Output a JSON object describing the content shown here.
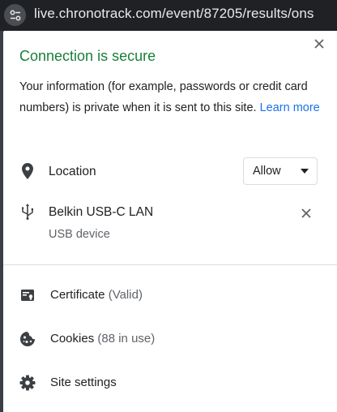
{
  "address_bar": {
    "url": "live.chronotrack.com/event/87205/results/ons",
    "site_info_icon": "tune-icon"
  },
  "popup": {
    "title": "Connection is secure",
    "description": "Your information (for example, passwords or credit card numbers) is private when it is sent to this site.",
    "learn_more": "Learn more",
    "close_icon": "close-icon",
    "colors": {
      "secure_green": "#188038",
      "link_blue": "#1a73e8"
    }
  },
  "permissions": {
    "location": {
      "icon": "location-pin-icon",
      "label": "Location",
      "value": "Allow"
    },
    "usb": {
      "icon": "usb-icon",
      "label": "Belkin USB-C LAN",
      "sub": "USB device"
    }
  },
  "menu": [
    {
      "icon": "certificate-icon",
      "label": "Certificate",
      "detail": "(Valid)"
    },
    {
      "icon": "cookie-icon",
      "label": "Cookies",
      "detail": "(88 in use)"
    },
    {
      "icon": "gear-icon",
      "label": "Site settings",
      "detail": ""
    }
  ]
}
